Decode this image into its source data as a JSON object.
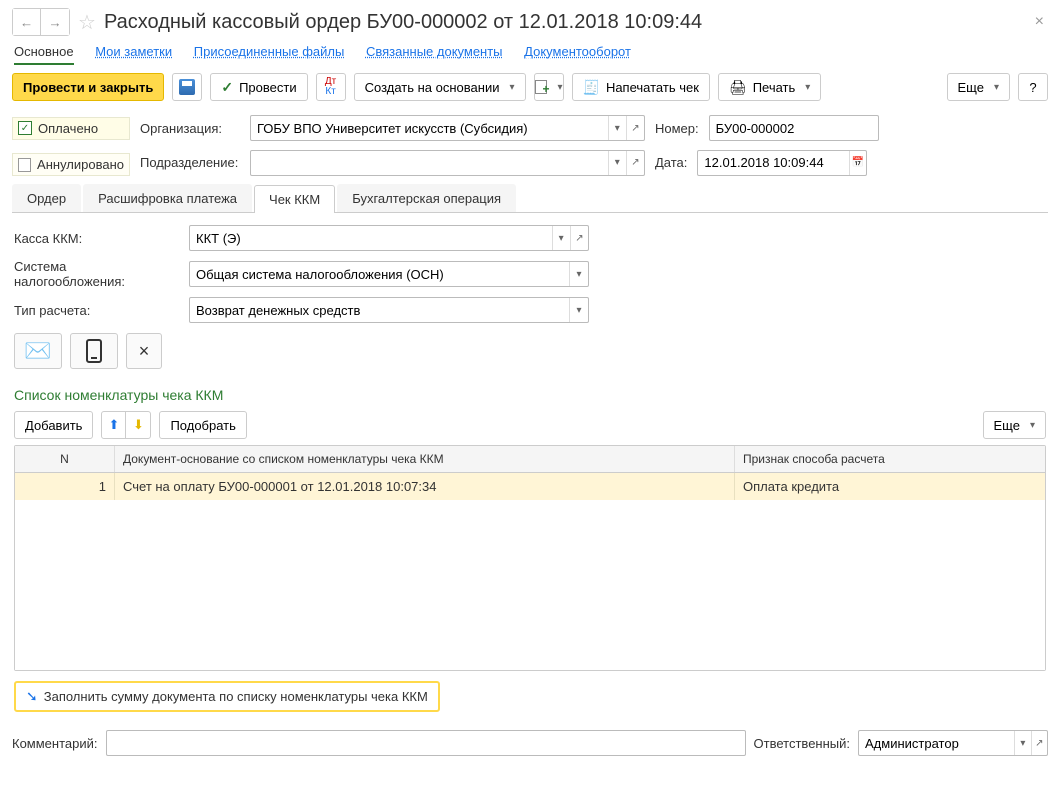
{
  "title": "Расходный кассовый ордер БУ00-000002 от 12.01.2018 10:09:44",
  "nav": {
    "main": "Основное",
    "notes": "Мои заметки",
    "files": "Присоединенные файлы",
    "docs": "Связанные документы",
    "workflow": "Документооборот"
  },
  "toolbar": {
    "post_close": "Провести и закрыть",
    "post": "Провести",
    "create_based": "Создать на основании",
    "print_receipt": "Напечатать чек",
    "print": "Печать",
    "more": "Еще",
    "help": "?"
  },
  "status": {
    "paid": "Оплачено",
    "cancelled": "Аннулировано"
  },
  "fields": {
    "org_label": "Организация:",
    "org_value": "ГОБУ ВПО Университет искусств (Субсидия)",
    "dept_label": "Подразделение:",
    "dept_value": "",
    "number_label": "Номер:",
    "number_value": "БУ00-000002",
    "date_label": "Дата:",
    "date_value": "12.01.2018 10:09:44"
  },
  "tabs": {
    "order": "Ордер",
    "breakdown": "Расшифровка платежа",
    "receipt": "Чек ККМ",
    "accounting": "Бухгалтерская операция"
  },
  "receipt_tab": {
    "cashbox_label": "Касса ККМ:",
    "cashbox_value": "ККТ (Э)",
    "tax_label": "Система налогообложения:",
    "tax_value": "Общая система налогообложения (ОСН)",
    "type_label": "Тип расчета:",
    "type_value": "Возврат денежных средств"
  },
  "nomenclature": {
    "title": "Список номенклатуры чека ККМ",
    "add": "Добавить",
    "select": "Подобрать",
    "more": "Еще",
    "col_n": "N",
    "col_doc": "Документ-основание со списком номенклатуры чека ККМ",
    "col_type": "Признак способа расчета",
    "rows": [
      {
        "n": "1",
        "doc": "Счет на оплату БУ00-000001 от 12.01.2018 10:07:34",
        "type": "Оплата кредита"
      }
    ],
    "fill_btn": "Заполнить сумму документа по списку номенклатуры чека ККМ"
  },
  "footer": {
    "comment_label": "Комментарий:",
    "comment_value": "",
    "resp_label": "Ответственный:",
    "resp_value": "Администратор"
  }
}
